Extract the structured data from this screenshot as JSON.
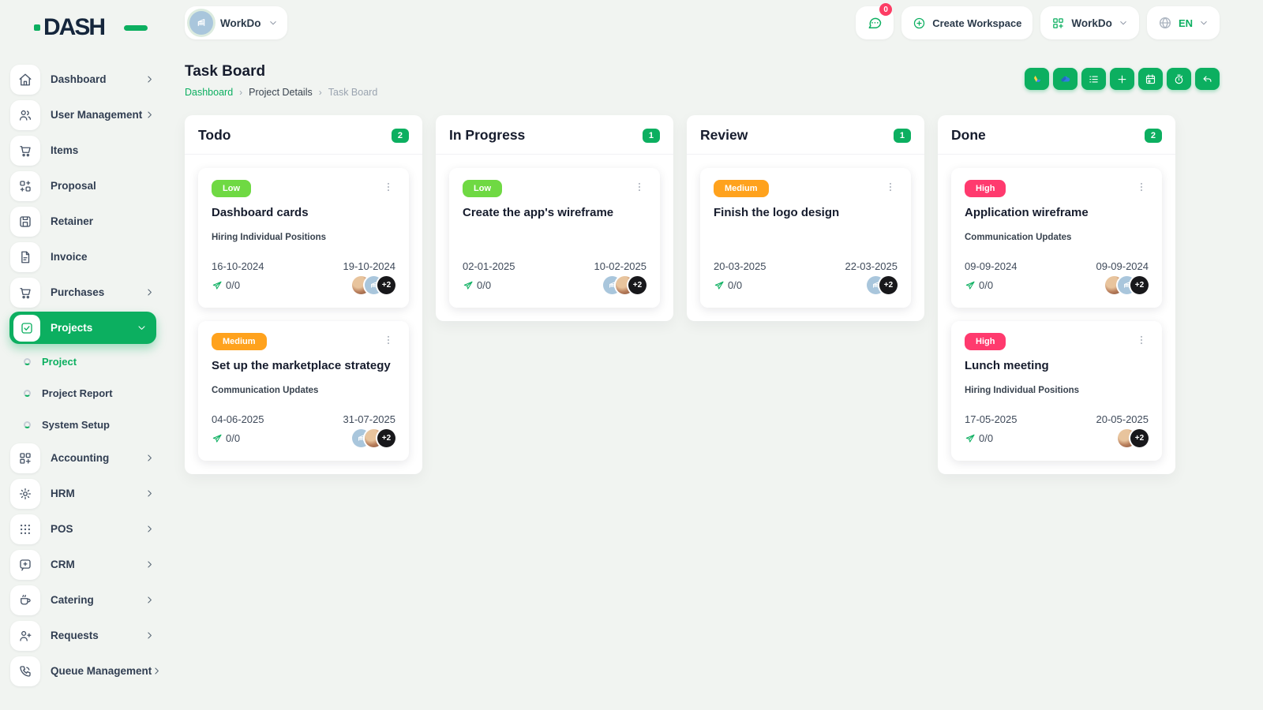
{
  "app": {
    "logo_text": "DASH"
  },
  "colors": {
    "primary": "#0caf60",
    "priority": {
      "Low": "#6fd943",
      "Medium": "#ffa21d",
      "High": "#ff3a6e"
    },
    "badge_red": "#fd3c64",
    "avatar_blue": "#a9c6dc"
  },
  "header": {
    "workspace": {
      "label": "WorkDo",
      "avatar_icon": "building-icon"
    },
    "messages": {
      "icon": "chat-bubble-icon",
      "badge": "0"
    },
    "create_workspace_label": "Create Workspace",
    "workdo_menu_label": "WorkDo",
    "language": {
      "code": "EN",
      "icon": "globe-icon"
    }
  },
  "sidebar": {
    "items": [
      {
        "label": "Dashboard",
        "icon": "home-icon",
        "chevron": "right",
        "active": false
      },
      {
        "label": "User Management",
        "icon": "users-icon",
        "chevron": "right",
        "active": false
      },
      {
        "label": "Items",
        "icon": "cart-icon",
        "chevron": "none",
        "active": false
      },
      {
        "label": "Proposal",
        "icon": "swap-boxes-icon",
        "chevron": "none",
        "active": false
      },
      {
        "label": "Retainer",
        "icon": "save-icon",
        "chevron": "none",
        "active": false
      },
      {
        "label": "Invoice",
        "icon": "file-icon",
        "chevron": "none",
        "active": false
      },
      {
        "label": "Purchases",
        "icon": "cart-icon",
        "chevron": "right",
        "active": false
      },
      {
        "label": "Projects",
        "icon": "checkbox-icon",
        "chevron": "down",
        "active": true,
        "children": [
          {
            "label": "Project",
            "active": true
          },
          {
            "label": "Project Report",
            "active": false
          },
          {
            "label": "System Setup",
            "active": false
          }
        ]
      },
      {
        "label": "Accounting",
        "icon": "grid-plus-icon",
        "chevron": "right",
        "active": false
      },
      {
        "label": "HRM",
        "icon": "target-icon",
        "chevron": "right",
        "active": false
      },
      {
        "label": "POS",
        "icon": "dots-grid-icon",
        "chevron": "right",
        "active": false
      },
      {
        "label": "CRM",
        "icon": "chat-square-icon",
        "chevron": "right",
        "active": false
      },
      {
        "label": "Catering",
        "icon": "coffee-icon",
        "chevron": "right",
        "active": false
      },
      {
        "label": "Requests",
        "icon": "user-plus-icon",
        "chevron": "right",
        "active": false
      },
      {
        "label": "Queue Management",
        "icon": "phone-icon",
        "chevron": "right",
        "active": false
      }
    ]
  },
  "page": {
    "title": "Task Board",
    "breadcrumb": [
      "Dashboard",
      "Project Details",
      "Task Board"
    ],
    "breadcrumb_separator": "›"
  },
  "toolbar": {
    "buttons": [
      {
        "name": "google-drive-button",
        "icon": "google-drive-icon"
      },
      {
        "name": "onedrive-button",
        "icon": "onedrive-icon"
      },
      {
        "name": "list-view-button",
        "icon": "list-icon"
      },
      {
        "name": "add-task-button",
        "icon": "plus-icon"
      },
      {
        "name": "calendar-button",
        "icon": "calendar-icon"
      },
      {
        "name": "timer-button",
        "icon": "stopwatch-icon"
      },
      {
        "name": "back-button",
        "icon": "undo-icon"
      }
    ]
  },
  "board": {
    "columns": [
      {
        "title": "Todo",
        "count": "2",
        "cards": [
          {
            "priority": "Low",
            "title": "Dashboard cards",
            "project": "Hiring Individual Positions",
            "start_date": "16-10-2024",
            "end_date": "19-10-2024",
            "progress": "0/0",
            "avatars": [
              "photo",
              "building"
            ],
            "extra": "+2"
          },
          {
            "priority": "Medium",
            "title": "Set up the marketplace strategy",
            "project": "Communication Updates",
            "start_date": "04-06-2025",
            "end_date": "31-07-2025",
            "progress": "0/0",
            "avatars": [
              "building",
              "photo"
            ],
            "extra": "+2"
          }
        ]
      },
      {
        "title": "In Progress",
        "count": "1",
        "cards": [
          {
            "priority": "Low",
            "title": "Create the app's wireframe",
            "project": "",
            "start_date": "02-01-2025",
            "end_date": "10-02-2025",
            "progress": "0/0",
            "avatars": [
              "building",
              "photo"
            ],
            "extra": "+2"
          }
        ]
      },
      {
        "title": "Review",
        "count": "1",
        "cards": [
          {
            "priority": "Medium",
            "title": "Finish the logo design",
            "project": "",
            "start_date": "20-03-2025",
            "end_date": "22-03-2025",
            "progress": "0/0",
            "avatars": [
              "building"
            ],
            "extra": "+2"
          }
        ]
      },
      {
        "title": "Done",
        "count": "2",
        "cards": [
          {
            "priority": "High",
            "title": "Application wireframe",
            "project": "Communication Updates",
            "start_date": "09-09-2024",
            "end_date": "09-09-2024",
            "progress": "0/0",
            "avatars": [
              "photo",
              "building"
            ],
            "extra": "+2"
          },
          {
            "priority": "High",
            "title": "Lunch meeting",
            "project": "Hiring Individual Positions",
            "start_date": "17-05-2025",
            "end_date": "20-05-2025",
            "progress": "0/0",
            "avatars": [
              "photo"
            ],
            "extra": "+2"
          }
        ]
      }
    ]
  }
}
